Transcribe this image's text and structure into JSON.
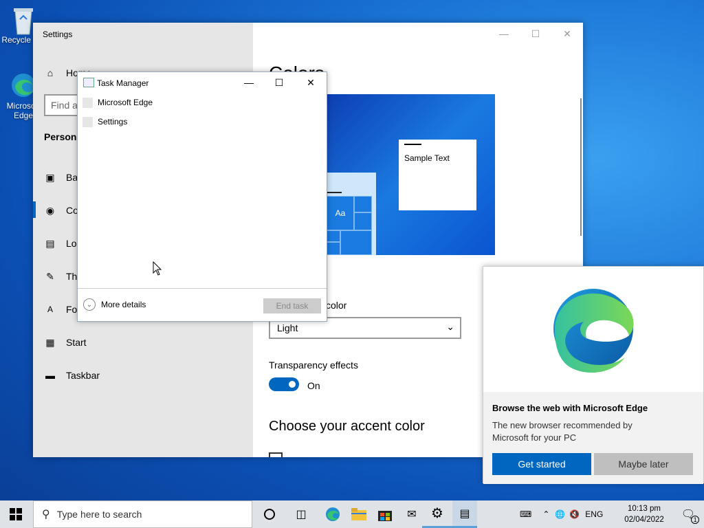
{
  "desktop": {
    "icons": [
      {
        "label": "Recycle Bin",
        "icon": "recycle-bin-icon"
      },
      {
        "label": "Microsoft Edge",
        "icon": "edge-icon"
      }
    ]
  },
  "settings": {
    "title": "Settings",
    "home_label": "Home",
    "find_placeholder": "Find a setting",
    "section_heading": "Personalisation",
    "nav_items": [
      {
        "label": "Background",
        "icon": "picture-icon"
      },
      {
        "label": "Colours",
        "icon": "palette-icon"
      },
      {
        "label": "Lock screen",
        "icon": "lock-screen-icon"
      },
      {
        "label": "Themes",
        "icon": "themes-icon"
      },
      {
        "label": "Fonts",
        "icon": "fonts-icon"
      },
      {
        "label": "Start",
        "icon": "start-icon"
      },
      {
        "label": "Taskbar",
        "icon": "taskbar-icon"
      }
    ],
    "page_title": "Colors",
    "preview_sample_text": "Sample Text",
    "preview_tile_text": "Aa",
    "mode_label": "color",
    "mode_value": "Light",
    "transparency_label": "Transparency effects",
    "transparency_state": "On",
    "accent_heading": "Choose your accent color",
    "accent_color": "#0067c0"
  },
  "task_manager": {
    "title": "Task Manager",
    "apps": [
      "Microsoft Edge",
      "Settings"
    ],
    "more_details": "More details",
    "end_task": "End task"
  },
  "edge_promo": {
    "heading": "Browse the web with Microsoft Edge",
    "body": "The new browser recommended by Microsoft for your PC",
    "primary_button": "Get started",
    "secondary_button": "Maybe later"
  },
  "taskbar": {
    "search_placeholder": "Type here to search",
    "language": "ENG",
    "time": "10:13 pm",
    "date": "02/04/2022",
    "notification_count": "1"
  }
}
